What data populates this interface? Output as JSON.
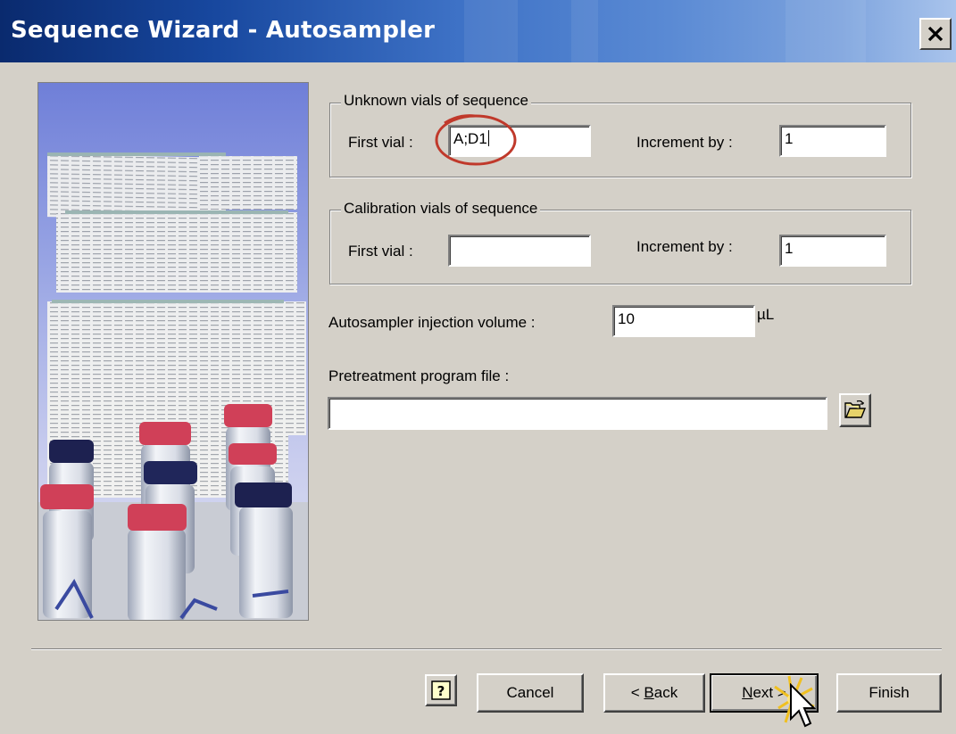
{
  "window": {
    "title": "Sequence Wizard - Autosampler",
    "close_glyph": "✕"
  },
  "unknown_group": {
    "legend": "Unknown vials of sequence",
    "first_vial_label": "First vial :",
    "first_vial_value": "A;D1",
    "increment_label": "Increment by :",
    "increment_value": "1"
  },
  "calibration_group": {
    "legend": "Calibration vials of sequence",
    "first_vial_label": "First vial :",
    "first_vial_value": "",
    "increment_label": "Increment by :",
    "increment_value": "1"
  },
  "injection": {
    "label": "Autosampler injection volume :",
    "value": "10",
    "unit": "µL"
  },
  "pretreatment": {
    "label": "Pretreatment program file :",
    "value": ""
  },
  "buttons": {
    "help_icon": "help-icon",
    "cancel": "Cancel",
    "back_prefix": "< ",
    "back_mnemonic": "B",
    "back_rest": "ack",
    "next_mnemonic": "N",
    "next_rest": "ext >",
    "finish": "Finish"
  },
  "colors": {
    "face": "#d4d0c8",
    "title_dark": "#0a2a6e",
    "title_light": "#a9c4ec",
    "highlight_circle": "#c0392b"
  }
}
